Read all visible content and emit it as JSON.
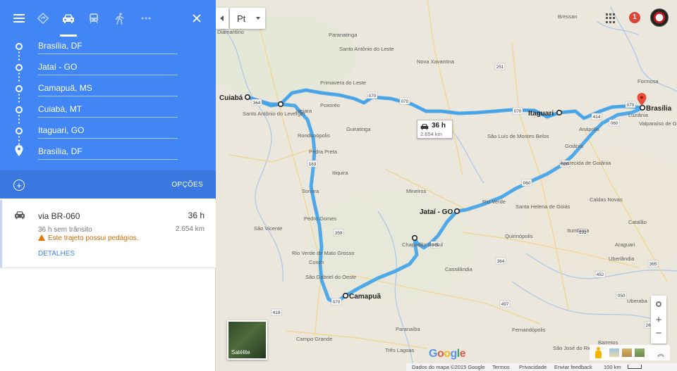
{
  "panel": {
    "top_bar": {
      "menu_icon": "menu-icon",
      "modes": [
        "directions-best-icon",
        "car-icon",
        "transit-icon",
        "walk-icon",
        "more-icon"
      ],
      "close_icon": "close-icon"
    },
    "stops": [
      {
        "label": "Brasília, DF",
        "icon": "waypoint-circle-icon"
      },
      {
        "label": "Jataí - GO",
        "icon": "waypoint-circle-icon"
      },
      {
        "label": "Camapuã, MS",
        "icon": "waypoint-circle-icon"
      },
      {
        "label": "Cuiabá, MT",
        "icon": "waypoint-circle-icon"
      },
      {
        "label": "Itaguari, GO",
        "icon": "waypoint-circle-icon"
      },
      {
        "label": "Brasília, DF",
        "icon": "destination-pin-icon"
      }
    ],
    "add_destination_icon": "plus-circle-icon",
    "options_label": "OPÇÕES",
    "route": {
      "via": "via BR-060",
      "time": "36 h",
      "traffic": "36 h sem trânsito",
      "distance": "2.654 km",
      "warning": "Este trajeto possui pedágios.",
      "details_label": "DETALHES"
    }
  },
  "map": {
    "language_button": "Pt",
    "notification_count": "1",
    "route_box": {
      "time": "36 h",
      "distance": "2.654 km"
    },
    "route_color": "#4fa9e8",
    "cities": {
      "cuiaba": "Cuiabá",
      "jatai": "Jataí - GO",
      "camapua": "Camapuã",
      "itaguari": "Itaguari",
      "brasilia": "Brasília"
    },
    "place_labels": {
      "diamantino": "Diamantino",
      "paranatinga": "Paranatinga",
      "santo_antonio_leste": "Santo Antônio do Leste",
      "nova_xavantina": "Nova Xavantina",
      "primavera": "Primavera do Leste",
      "poxoreo": "Poxoréo",
      "guiratinga": "Guiratinga",
      "santo_antonio_leverger": "Santo Antônio do Leverger",
      "jaciara": "Jaciara",
      "rondonopolis": "Rondonópolis",
      "pedra_preta": "Pedra Preta",
      "itiquira": "Itiquira",
      "sonora": "Sonora",
      "pedro_gomes": "Pedro Gomes",
      "sao_vicente": "São Vicente",
      "rio_verde_mt": "Rio Verde de Mato Grosso",
      "coxim": "Coxim",
      "sao_gabriel": "São Gabriel do Oeste",
      "campo_grande": "Campo Grande",
      "chapadao": "Chapadão do Sul",
      "cassilandia": "Cassilândia",
      "mineiros": "Mineiros",
      "rio_verde": "Rio Verde",
      "santa_helena": "Santa Helena de Goiás",
      "goiania": "Goiânia",
      "aparecida": "Aparecida de Goiânia",
      "anapolis": "Anápolis",
      "sao_luis": "São Luís de Montes Belos",
      "caldas_novas": "Caldas Novas",
      "catalao": "Catalão",
      "quirinopolis": "Quirinópolis",
      "itumbiara": "Itumbiara",
      "uberlandia": "Uberlândia",
      "araguari": "Araguari",
      "uberaba": "Uberaba",
      "fernandopolis": "Fernandópolis",
      "barretos": "Barretos",
      "sao_jose_rio_preto": "São José do Rio Preto",
      "paranaiba": "Paranaíba",
      "tres_lagoas": "Três Lagoas",
      "luziania": "Luziânia",
      "valparaiso": "Valparaíso de Goiás",
      "bressan": "Bressan",
      "formosa": "Formosa"
    },
    "shields": [
      "364",
      "070",
      "070",
      "070",
      "070",
      "060",
      "060",
      "060",
      "163",
      "359",
      "364",
      "060",
      "251",
      "414",
      "070",
      "153",
      "452",
      "050",
      "497",
      "365",
      "262",
      "419"
    ],
    "satellite_label": "Satélite",
    "attribution": {
      "data": "Dados do mapa ©2015 Google",
      "terms": "Termos",
      "privacy": "Privacidade",
      "feedback": "Enviar feedback",
      "scale": "100 km"
    },
    "google_logo": [
      "G",
      "o",
      "o",
      "g",
      "l",
      "e"
    ]
  }
}
